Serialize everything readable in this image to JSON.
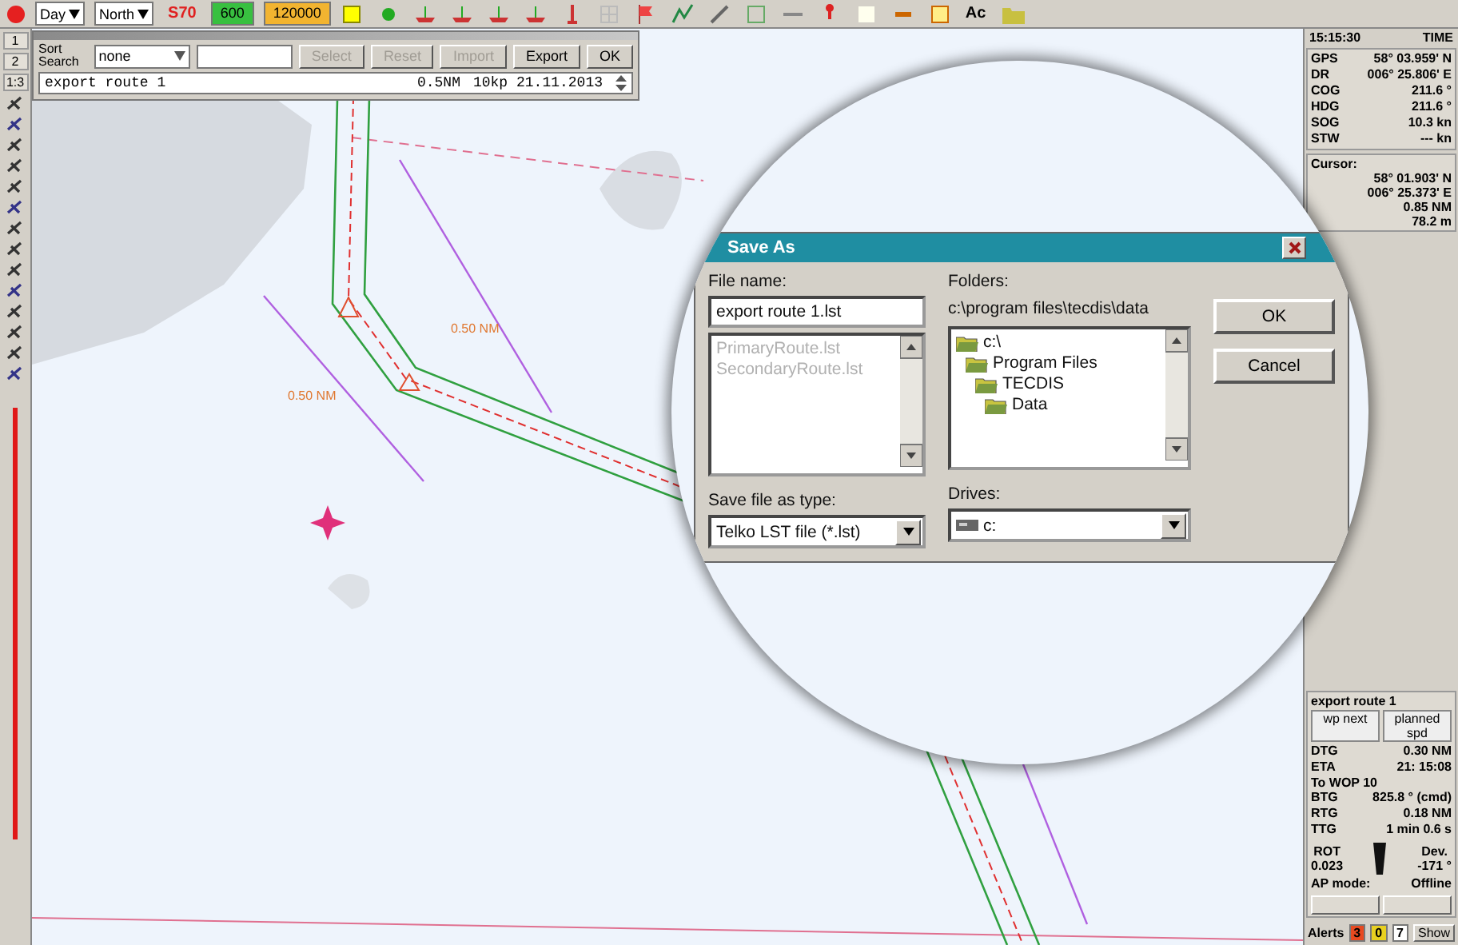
{
  "toolbar": {
    "items": [
      {
        "kind": "dropdown",
        "text": "Day"
      },
      {
        "kind": "dropdown",
        "text": "North"
      },
      {
        "kind": "text",
        "text": "S70",
        "color": "#e02020"
      },
      {
        "kind": "badge",
        "text": "600",
        "color": "#38c040"
      },
      {
        "kind": "badge",
        "text": "120000",
        "color": "#f2b430"
      }
    ],
    "end_label": "Ac"
  },
  "side_strip": {
    "labels": [
      "1",
      "2",
      "1:3"
    ]
  },
  "route_window": {
    "sort_label": "Sort Search",
    "sort_value": "none",
    "buttons": [
      {
        "label": "Select",
        "disabled": true
      },
      {
        "label": "Reset",
        "disabled": true
      },
      {
        "label": "Import",
        "disabled": true
      },
      {
        "label": "Export",
        "disabled": false
      },
      {
        "label": "OK",
        "disabled": false
      }
    ],
    "row": {
      "name": "export route 1",
      "xtd": "0.5NM",
      "info": "10kp 21.11.2013"
    }
  },
  "chart": {
    "labels": [
      "0.50 NM",
      "0.50 NM"
    ]
  },
  "nav_panel": {
    "time": "15:15:30",
    "time_label": "TIME",
    "rows": [
      {
        "label": "GPS",
        "value": "58° 03.959' N"
      },
      {
        "label": "DR",
        "value": "006° 25.806' E"
      },
      {
        "label": "COG",
        "value": "211.6 °"
      },
      {
        "label": "HDG",
        "value": "211.6 °"
      },
      {
        "label": "SOG",
        "value": "10.3 kn"
      },
      {
        "label": "STW",
        "value": "--- kn"
      }
    ],
    "cursor_label": "Cursor:",
    "cursor_values": [
      "58° 01.903' N",
      "006° 25.373' E",
      "0.85 NM",
      "78.2 m"
    ]
  },
  "route_info": {
    "title": "export route 1",
    "columns": [
      "wp next",
      "planned spd"
    ],
    "rows": [
      {
        "label": "DTG",
        "value": "0.30 NM"
      },
      {
        "label": "ETA",
        "value": "21: 15:08"
      }
    ],
    "subtitle": "To WOP 10",
    "rows2": [
      {
        "label": "BTG",
        "value": "825.8 ° (cmd)"
      },
      {
        "label": "RTG",
        "value": "0.18 NM"
      },
      {
        "label": "TTG",
        "value": "1 min 0.6 s"
      }
    ],
    "rot": {
      "label": "ROT",
      "value": "0.023"
    },
    "dev": {
      "label": "Dev.",
      "value": "-171 °"
    },
    "ap_label": "AP mode:",
    "ap_value": "Offline"
  },
  "alerts": {
    "label": "Alerts",
    "counts": [
      {
        "text": "3",
        "color": "#e84a20"
      },
      {
        "text": "0",
        "color": "#e8d020"
      },
      {
        "text": "7",
        "color": "#ffffff"
      }
    ],
    "show": "Show"
  },
  "dialog": {
    "title": "Save As",
    "file_name_label": "File name:",
    "file_name": "export route 1.lst",
    "files": [
      {
        "name": "PrimaryRoute.lst",
        "disabled": true
      },
      {
        "name": "SecondaryRoute.lst",
        "disabled": true
      }
    ],
    "folders_label": "Folders:",
    "folder_path": "c:\\program files\\tecdis\\data",
    "tree": [
      {
        "name": "c:\\",
        "children": [
          {
            "name": "Program Files",
            "children": [
              {
                "name": "TECDIS",
                "children": [
                  {
                    "name": "Data"
                  }
                ]
              }
            ]
          }
        ]
      }
    ],
    "ok": "OK",
    "cancel": "Cancel",
    "type_label": "Save file as type:",
    "type_value": "Telko LST file (*.lst)",
    "drives_label": "Drives:",
    "drive_value": "c:"
  }
}
